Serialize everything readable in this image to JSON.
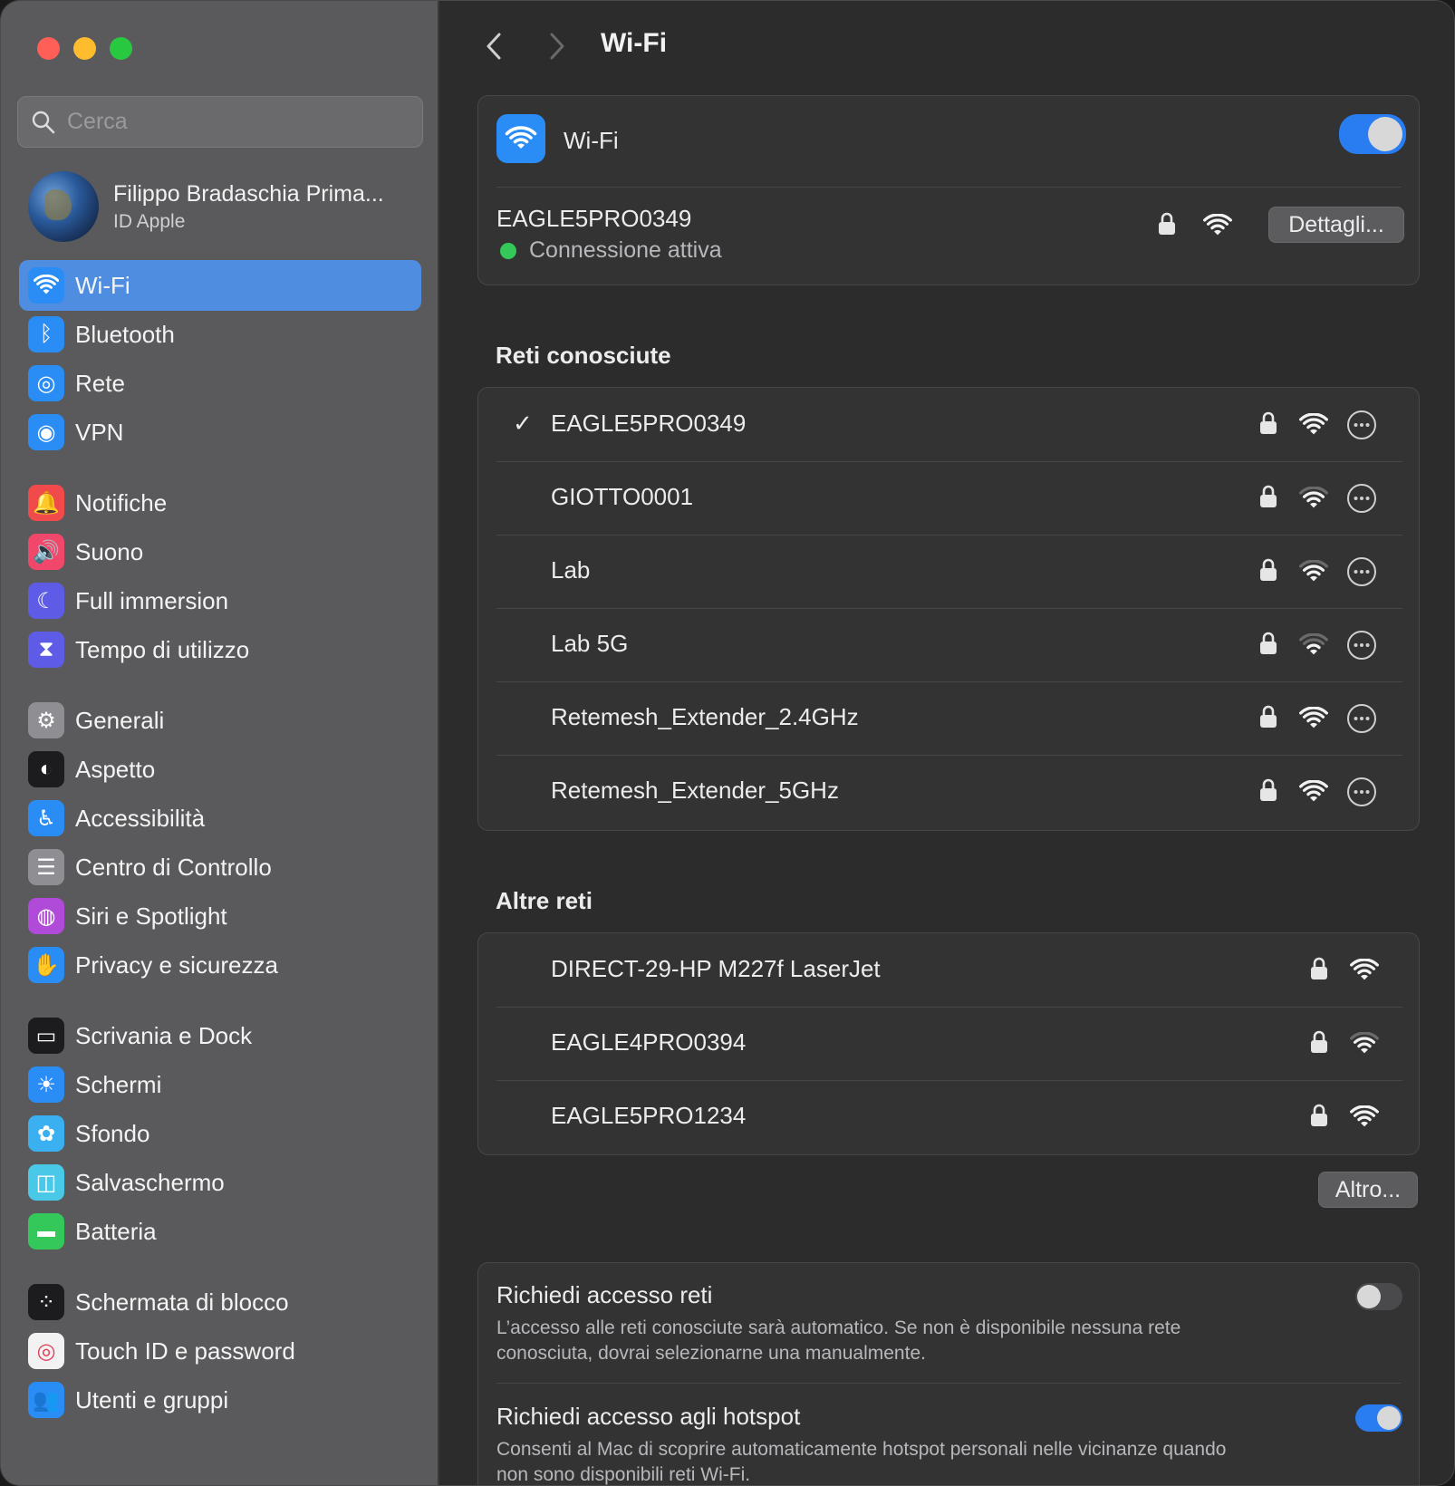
{
  "window": {
    "title": "Wi-Fi"
  },
  "sidebar": {
    "search_placeholder": "Cerca",
    "profile": {
      "name": "Filippo Bradaschia Prima...",
      "subtitle": "ID Apple"
    },
    "items": [
      {
        "label": "Wi-Fi",
        "icon": "wifi-icon",
        "color": "#2a8cf5",
        "active": true
      },
      {
        "label": "Bluetooth",
        "icon": "bluetooth-icon",
        "color": "#2a8cf5"
      },
      {
        "label": "Rete",
        "icon": "globe-icon",
        "color": "#2a8cf5"
      },
      {
        "label": "VPN",
        "icon": "vpn-globe-icon",
        "color": "#2a8cf5"
      },
      {
        "label": "Notifiche",
        "icon": "bell-icon",
        "color": "#f04a4a"
      },
      {
        "label": "Suono",
        "icon": "speaker-icon",
        "color": "#f0476a"
      },
      {
        "label": "Full immersion",
        "icon": "moon-icon",
        "color": "#5e5ce6"
      },
      {
        "label": "Tempo di utilizzo",
        "icon": "hourglass-icon",
        "color": "#5e5ce6"
      },
      {
        "label": "Generali",
        "icon": "gear-icon",
        "color": "#8e8e93"
      },
      {
        "label": "Aspetto",
        "icon": "appearance-icon",
        "color": "#1c1c1e"
      },
      {
        "label": "Accessibilità",
        "icon": "accessibility-icon",
        "color": "#2a8cf5"
      },
      {
        "label": "Centro di Controllo",
        "icon": "switches-icon",
        "color": "#8e8e93"
      },
      {
        "label": "Siri e Spotlight",
        "icon": "siri-icon",
        "color": "#b04ad8"
      },
      {
        "label": "Privacy e sicurezza",
        "icon": "hand-icon",
        "color": "#2a8cf5"
      },
      {
        "label": "Scrivania e Dock",
        "icon": "dock-icon",
        "color": "#1c1c1e"
      },
      {
        "label": "Schermi",
        "icon": "sun-icon",
        "color": "#2a8cf5"
      },
      {
        "label": "Sfondo",
        "icon": "flower-icon",
        "color": "#3ab0f0"
      },
      {
        "label": "Salvaschermo",
        "icon": "screensaver-icon",
        "color": "#4ac8e8"
      },
      {
        "label": "Batteria",
        "icon": "battery-icon",
        "color": "#34c759"
      },
      {
        "label": "Schermata di blocco",
        "icon": "lock-screen-icon",
        "color": "#1c1c1e"
      },
      {
        "label": "Touch ID e password",
        "icon": "fingerprint-icon",
        "color": "#f2f2f2"
      },
      {
        "label": "Utenti e gruppi",
        "icon": "users-icon",
        "color": "#2a8cf5"
      }
    ]
  },
  "main": {
    "title": "Wi-Fi",
    "wifi_card": {
      "label": "Wi-Fi",
      "enabled": true,
      "current_network": "EAGLE5PRO0349",
      "status": "Connessione attiva",
      "details_button": "Dettagli..."
    },
    "known_networks": {
      "title": "Reti conosciute",
      "items": [
        {
          "name": "EAGLE5PRO0349",
          "checked": true,
          "signal": 3
        },
        {
          "name": "GIOTTO0001",
          "checked": false,
          "signal": 2
        },
        {
          "name": "Lab",
          "checked": false,
          "signal": 2
        },
        {
          "name": "Lab 5G",
          "checked": false,
          "signal": 1
        },
        {
          "name": "Retemesh_Extender_2.4GHz",
          "checked": false,
          "signal": 3
        },
        {
          "name": "Retemesh_Extender_5GHz",
          "checked": false,
          "signal": 3
        }
      ]
    },
    "other_networks": {
      "title": "Altre reti",
      "items": [
        {
          "name": "DIRECT-29-HP M227f LaserJet",
          "signal": 3
        },
        {
          "name": "EAGLE4PRO0394",
          "signal": 2
        },
        {
          "name": "EAGLE5PRO1234",
          "signal": 3
        }
      ],
      "other_button": "Altro..."
    },
    "settings": [
      {
        "title": "Richiedi accesso reti",
        "description_line1": "L’accesso alle reti conosciute sarà automatico. Se non è disponibile nessuna rete",
        "description_line2": "conosciuta, dovrai selezionarne una manualmente.",
        "enabled": false
      },
      {
        "title": "Richiedi accesso agli hotspot",
        "description_line1": "Consenti al Mac di scoprire automaticamente hotspot personali nelle vicinanze quando",
        "description_line2": "non sono disponibili reti Wi-Fi.",
        "enabled": true
      }
    ]
  },
  "colors": {
    "accent": "#2a8cf5",
    "sidebar_active": "#4f8de0",
    "status_green": "#34c759"
  }
}
